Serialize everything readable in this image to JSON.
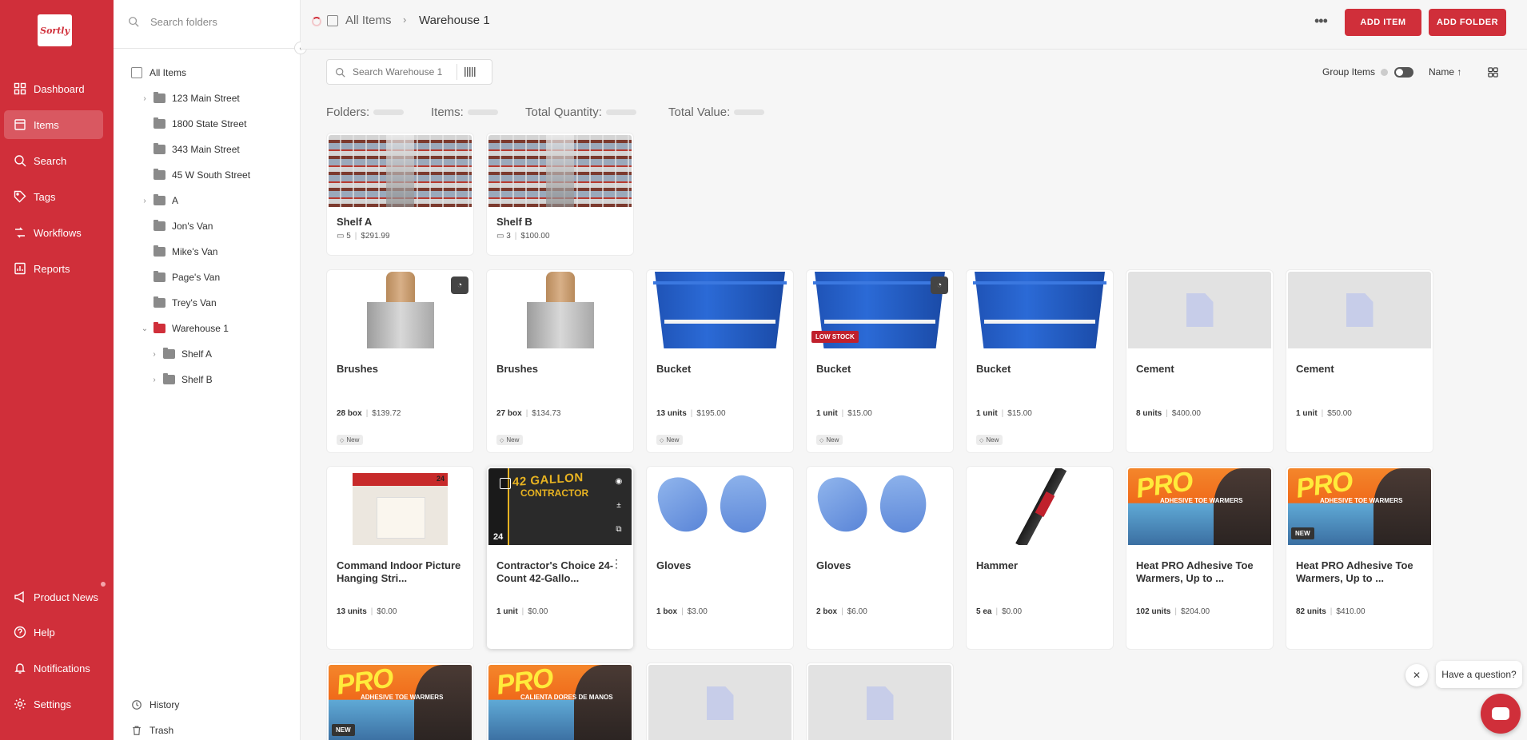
{
  "app": {
    "logo_text": "Sortly"
  },
  "leftnav": {
    "items": [
      {
        "label": "Dashboard",
        "icon": "dashboard-icon"
      },
      {
        "label": "Items",
        "icon": "items-icon",
        "active": true
      },
      {
        "label": "Search",
        "icon": "search-icon"
      },
      {
        "label": "Tags",
        "icon": "tag-icon"
      },
      {
        "label": "Workflows",
        "icon": "workflow-icon"
      },
      {
        "label": "Reports",
        "icon": "reports-icon"
      }
    ],
    "bottom": [
      {
        "label": "Product News",
        "icon": "megaphone-icon"
      },
      {
        "label": "Help",
        "icon": "help-icon"
      },
      {
        "label": "Notifications",
        "icon": "bell-icon"
      },
      {
        "label": "Settings",
        "icon": "gear-icon"
      }
    ]
  },
  "folders": {
    "search_placeholder": "Search folders",
    "all_items": "All Items",
    "tree": [
      {
        "label": "123 Main Street",
        "expandable": true
      },
      {
        "label": "1800 State Street",
        "expandable": false
      },
      {
        "label": "343 Main Street",
        "expandable": false
      },
      {
        "label": "45 W South Street",
        "expandable": false
      },
      {
        "label": "A",
        "expandable": true
      },
      {
        "label": "Jon's Van",
        "expandable": false
      },
      {
        "label": "Mike's Van",
        "expandable": false
      },
      {
        "label": "Page's Van",
        "expandable": false
      },
      {
        "label": "Trey's Van",
        "expandable": false
      },
      {
        "label": "Warehouse 1",
        "expandable": true,
        "expanded": true,
        "selected": true
      }
    ],
    "children": [
      {
        "label": "Shelf A"
      },
      {
        "label": "Shelf B"
      }
    ],
    "history": "History",
    "trash": "Trash"
  },
  "header": {
    "breadcrumb_root": "All Items",
    "breadcrumb_sep": "›",
    "breadcrumb_current": "Warehouse 1",
    "add_item": "ADD ITEM",
    "add_folder": "ADD FOLDER"
  },
  "toolbar": {
    "search_placeholder": "Search Warehouse 1",
    "group_items": "Group Items",
    "sort": "Name ↑"
  },
  "summary": {
    "folders": "Folders:",
    "items": "Items:",
    "total_quantity": "Total Quantity:",
    "total_value": "Total Value:"
  },
  "folder_cards": [
    {
      "title": "Shelf A",
      "count": "5",
      "value": "$291.99"
    },
    {
      "title": "Shelf B",
      "count": "3",
      "value": "$100.00"
    }
  ],
  "items": [
    {
      "title": "Brushes",
      "qty": "28 box",
      "price": "$139.72",
      "tag": "New",
      "img": "brush",
      "badge_icon": true
    },
    {
      "title": "Brushes",
      "qty": "27 box",
      "price": "$134.73",
      "tag": "New",
      "img": "brush"
    },
    {
      "title": "Bucket",
      "qty": "13 units",
      "price": "$195.00",
      "tag": "New",
      "img": "bucket"
    },
    {
      "title": "Bucket",
      "qty": "1 unit",
      "price": "$15.00",
      "tag": "New",
      "img": "bucket",
      "badge_icon": true,
      "low_stock": "LOW STOCK"
    },
    {
      "title": "Bucket",
      "qty": "1 unit",
      "price": "$15.00",
      "tag": "New",
      "img": "bucket"
    },
    {
      "title": "Cement",
      "qty": "8 units",
      "price": "$400.00",
      "img": "doc"
    },
    {
      "title": "Cement",
      "qty": "1 unit",
      "price": "$50.00",
      "img": "doc"
    },
    {
      "title": "Command Indoor Picture Hanging Stri...",
      "qty": "13 units",
      "price": "$0.00",
      "img": "strips",
      "strips_num": "24"
    },
    {
      "title": "Contractor's Choice 24-Count 42-Gallo...",
      "qty": "1 unit",
      "price": "$0.00",
      "img": "bags",
      "hover": true,
      "bags_label": "42 GALLON",
      "bags_sub": "CONTRACTOR",
      "bags_count": "24"
    },
    {
      "title": "Gloves",
      "qty": "1 box",
      "price": "$3.00",
      "img": "gloves"
    },
    {
      "title": "Gloves",
      "qty": "2 box",
      "price": "$6.00",
      "img": "gloves"
    },
    {
      "title": "Hammer",
      "qty": "5 ea",
      "price": "$0.00",
      "img": "hammer"
    },
    {
      "title": "Heat PRO Adhesive Toe Warmers, Up to ...",
      "qty": "102 units",
      "price": "$204.00",
      "img": "pro",
      "pro_text": "PRO",
      "pro_sub": "ADHESIVE TOE WARMERS"
    },
    {
      "title": "Heat PRO Adhesive Toe Warmers, Up to ...",
      "qty": "82 units",
      "price": "$410.00",
      "img": "pro",
      "new_badge": "NEW",
      "pro_text": "PRO",
      "pro_sub": "ADHESIVE TOE WARMERS"
    },
    {
      "img": "pro",
      "new_badge": "NEW",
      "pro_text": "PRO",
      "pro_sub": "ADHESIVE TOE WARMERS"
    },
    {
      "img": "pro",
      "pro_text": "PRO",
      "pro_sub": "CALIENTA DORES DE MANOS"
    },
    {
      "img": "doc"
    },
    {
      "img": "doc"
    }
  ],
  "chat": {
    "prompt": "Have a question?"
  }
}
